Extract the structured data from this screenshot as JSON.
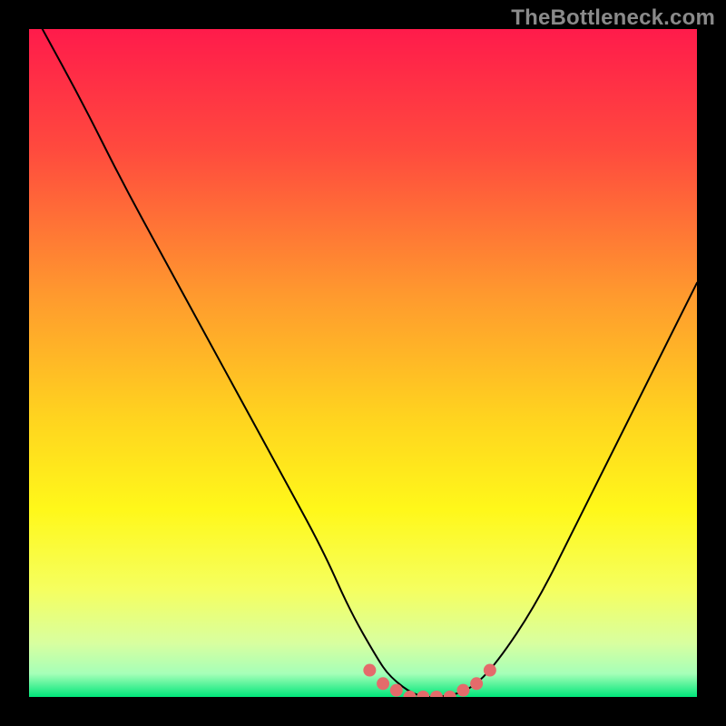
{
  "watermark": "TheBottleneck.com",
  "chart_data": {
    "type": "line",
    "title": "",
    "xlabel": "",
    "ylabel": "",
    "xlim": [
      0,
      100
    ],
    "ylim": [
      0,
      100
    ],
    "grid": false,
    "legend": false,
    "background_gradient": {
      "stops": [
        {
          "offset": 0.0,
          "color": "#ff1b4b"
        },
        {
          "offset": 0.18,
          "color": "#ff4a3e"
        },
        {
          "offset": 0.4,
          "color": "#ff9a2e"
        },
        {
          "offset": 0.58,
          "color": "#ffd31f"
        },
        {
          "offset": 0.72,
          "color": "#fff81a"
        },
        {
          "offset": 0.84,
          "color": "#f5ff60"
        },
        {
          "offset": 0.92,
          "color": "#d8ffa0"
        },
        {
          "offset": 0.965,
          "color": "#a6ffb8"
        },
        {
          "offset": 1.0,
          "color": "#00e67a"
        }
      ]
    },
    "series": [
      {
        "name": "bottleneck-curve",
        "stroke": "#000000",
        "x": [
          2,
          8,
          14,
          20,
          26,
          32,
          38,
          44,
          48,
          52,
          54,
          58,
          62,
          66,
          70,
          76,
          82,
          88,
          94,
          100
        ],
        "y": [
          100,
          89,
          77,
          66,
          55,
          44,
          33,
          22,
          13,
          6,
          3,
          0,
          0,
          1,
          5,
          14,
          26,
          38,
          50,
          62
        ]
      }
    ],
    "highlight": {
      "name": "flat-bottom-markers",
      "color": "#e46b6b",
      "x": [
        51,
        53,
        55,
        57,
        59,
        61,
        63,
        65,
        67,
        69
      ],
      "y": [
        4,
        2,
        1,
        0,
        0,
        0,
        0,
        1,
        2,
        4
      ]
    }
  }
}
